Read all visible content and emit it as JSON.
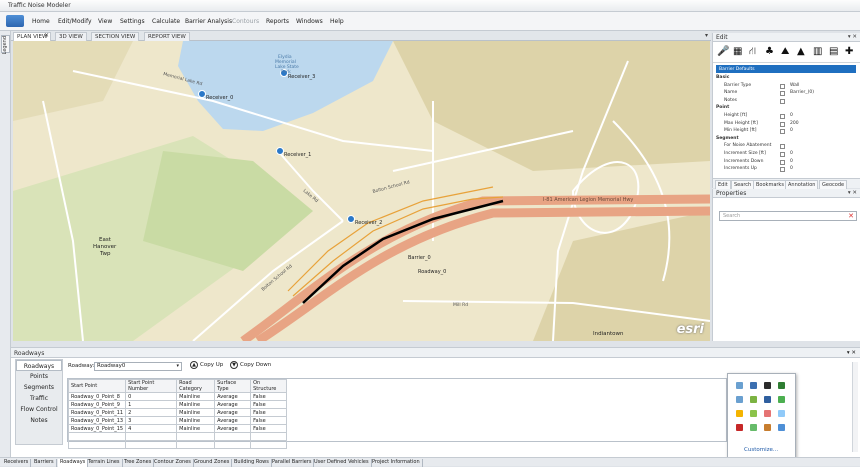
{
  "app": {
    "title": "Traffic Noise Modeler"
  },
  "menu": [
    "Home",
    "Edit/Modify",
    "View",
    "Settings",
    "Calculate",
    "Barrier Analysis",
    "Contours",
    "Reports",
    "Windows",
    "Help"
  ],
  "menu_disabled": "Contours",
  "left_strip": {
    "label": "Legend"
  },
  "view_tabs": [
    "PLAN VIEW",
    "3D VIEW",
    "SECTION VIEW",
    "REPORT VIEW"
  ],
  "map": {
    "water_label_1": "Elydia",
    "water_label_2": "Memorial",
    "water_label_3": "Lake State",
    "water_label_4": "Park",
    "receivers": [
      "Receiver_0",
      "Receiver_1",
      "Receiver_2",
      "Receiver_3"
    ],
    "roads": [
      "Memorial Lake Rd",
      "Lake Rd",
      "Lake Rd",
      "Memorial Lake Rd",
      "Lake Rd",
      "Fisher Ave",
      "Walnut Ave",
      "Wildflower Rd",
      "Memorial Lake Rd",
      "Indiana Rd",
      "Elm Rd",
      "Bolton School Rd",
      "Bolton School Rd",
      "Mill Rd"
    ],
    "highway": "I-81 American Legion Memorial Hwy",
    "highway_short": "I-81 N",
    "highway_short_2": "I-81 S",
    "barrier": "Barrier_0",
    "roadway": "Roadway_0",
    "town_1": "East",
    "town_2": "Hanover",
    "town_3": "Twp",
    "place": "Indiantown",
    "logo": "esri"
  },
  "edit_panel": {
    "title": "Edit",
    "selection": "Barrier Defaults",
    "rows": [
      {
        "label": "Basic",
        "section": true
      },
      {
        "label": "Barrier Type",
        "value": "Wall"
      },
      {
        "label": "Name",
        "value": "Barrier_(0)"
      },
      {
        "label": "Notes",
        "value": ""
      },
      {
        "label": "Point",
        "section": true
      },
      {
        "label": "Height [ft]",
        "value": "0"
      },
      {
        "label": "Max Height [ft]",
        "value": "200"
      },
      {
        "label": "Min Height [ft]",
        "value": "0"
      },
      {
        "label": "Segment",
        "section": true
      },
      {
        "label": "For Noise Abatement",
        "value": ""
      },
      {
        "label": "Increment Size [ft]",
        "value": "0"
      },
      {
        "label": "Increments Down",
        "value": "0"
      },
      {
        "label": "Increments Up",
        "value": "0"
      }
    ],
    "tabs": [
      "Edit",
      "Search",
      "Bookmarks",
      "Annotation",
      "Geocode"
    ]
  },
  "properties_panel": {
    "title": "Properties",
    "search_placeholder": "Search"
  },
  "roadways_panel": {
    "title": "Roadways",
    "nav": [
      "Roadways",
      "Points",
      "Segments",
      "Traffic",
      "Flow Control",
      "Notes"
    ],
    "roadway_label": "Roadway:",
    "roadway_value": "Roadway0",
    "copy_up": "Copy Up",
    "copy_down": "Copy Down",
    "columns": [
      "Start Point",
      "Start Point Number",
      "Road Category",
      "Surface Type",
      "On Structure"
    ],
    "rows": [
      [
        "Roadway_0_Point_8",
        "0",
        "Mainline",
        "Average",
        "False"
      ],
      [
        "Roadway_0_Point_9",
        "1",
        "Mainline",
        "Average",
        "False"
      ],
      [
        "Roadway_0_Point_11",
        "2",
        "Mainline",
        "Average",
        "False"
      ],
      [
        "Roadway_0_Point_13",
        "3",
        "Mainline",
        "Average",
        "False"
      ],
      [
        "Roadway_0_Point_15",
        "4",
        "Mainline",
        "Average",
        "False"
      ]
    ]
  },
  "popup": {
    "customize": "Customize..."
  },
  "bottom_tabs": [
    "Receivers",
    "Barriers",
    "Roadways",
    "Terrain Lines",
    "Tree Zones",
    "Contour Zones",
    "Ground Zones",
    "Building Rows",
    "Parallel Barriers",
    "User Defined Vehicles",
    "Project Information"
  ],
  "bottom_tab_active": "Roadways",
  "colors": {
    "accent": "#1f6fc0",
    "water": "#bcd8ee",
    "highway": "#e8a484",
    "barrier": "#000000",
    "receiver": "#2a78c8"
  }
}
